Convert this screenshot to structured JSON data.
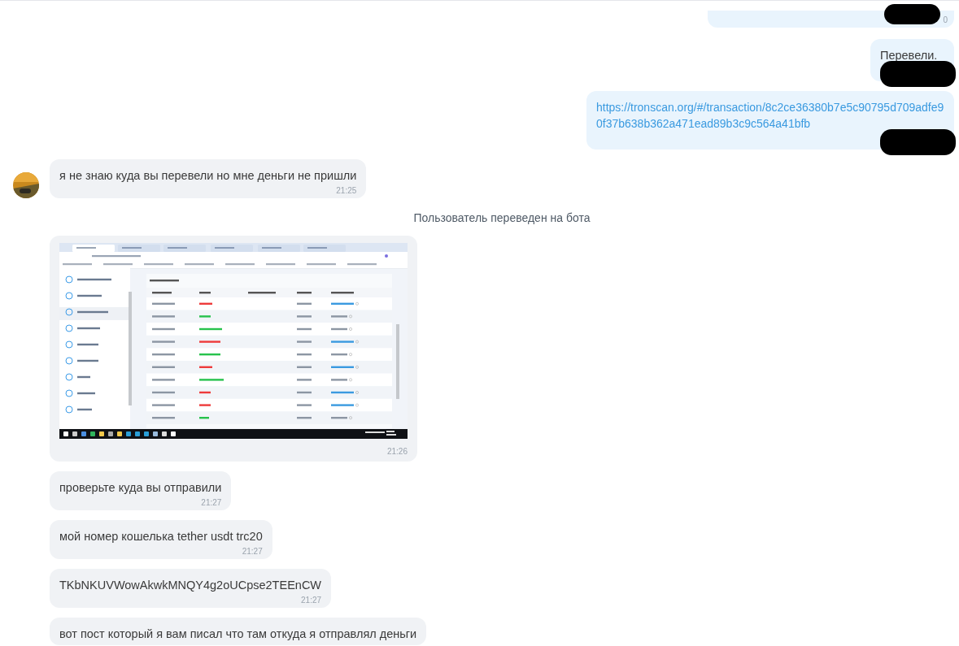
{
  "messages": [
    {
      "kind": "outgoing",
      "cut": true,
      "time": "0",
      "redacted": true
    },
    {
      "kind": "outgoing",
      "text": "Перевели.",
      "redacted": true
    },
    {
      "kind": "outgoing",
      "link": "https://tronscan.org/#/transaction/8c2ce36380b7e5c90795d709adfe90f37b638b362a471ead89b3c9c564a41bfb",
      "redacted": true
    },
    {
      "kind": "incoming",
      "avatar": true,
      "text": "я не знаю куда вы перевели но мне деньги не пришли",
      "time": "21:25"
    },
    {
      "kind": "system",
      "text": "Пользователь переведен на бота"
    },
    {
      "kind": "image",
      "time": "21:26"
    },
    {
      "kind": "incoming",
      "text": "проверьте куда вы отправили",
      "time": "21:27"
    },
    {
      "kind": "incoming",
      "text": "мой номер кошелька tether usdt trc20",
      "time": "21:27"
    },
    {
      "kind": "incoming",
      "text": "TKbNKUVWowAkwkMNQY4g2oUCpse2TEEnCW",
      "time": "21:27"
    },
    {
      "kind": "incoming",
      "text": "вот пост который я вам писал что там откуда я отправлял деньги"
    }
  ]
}
